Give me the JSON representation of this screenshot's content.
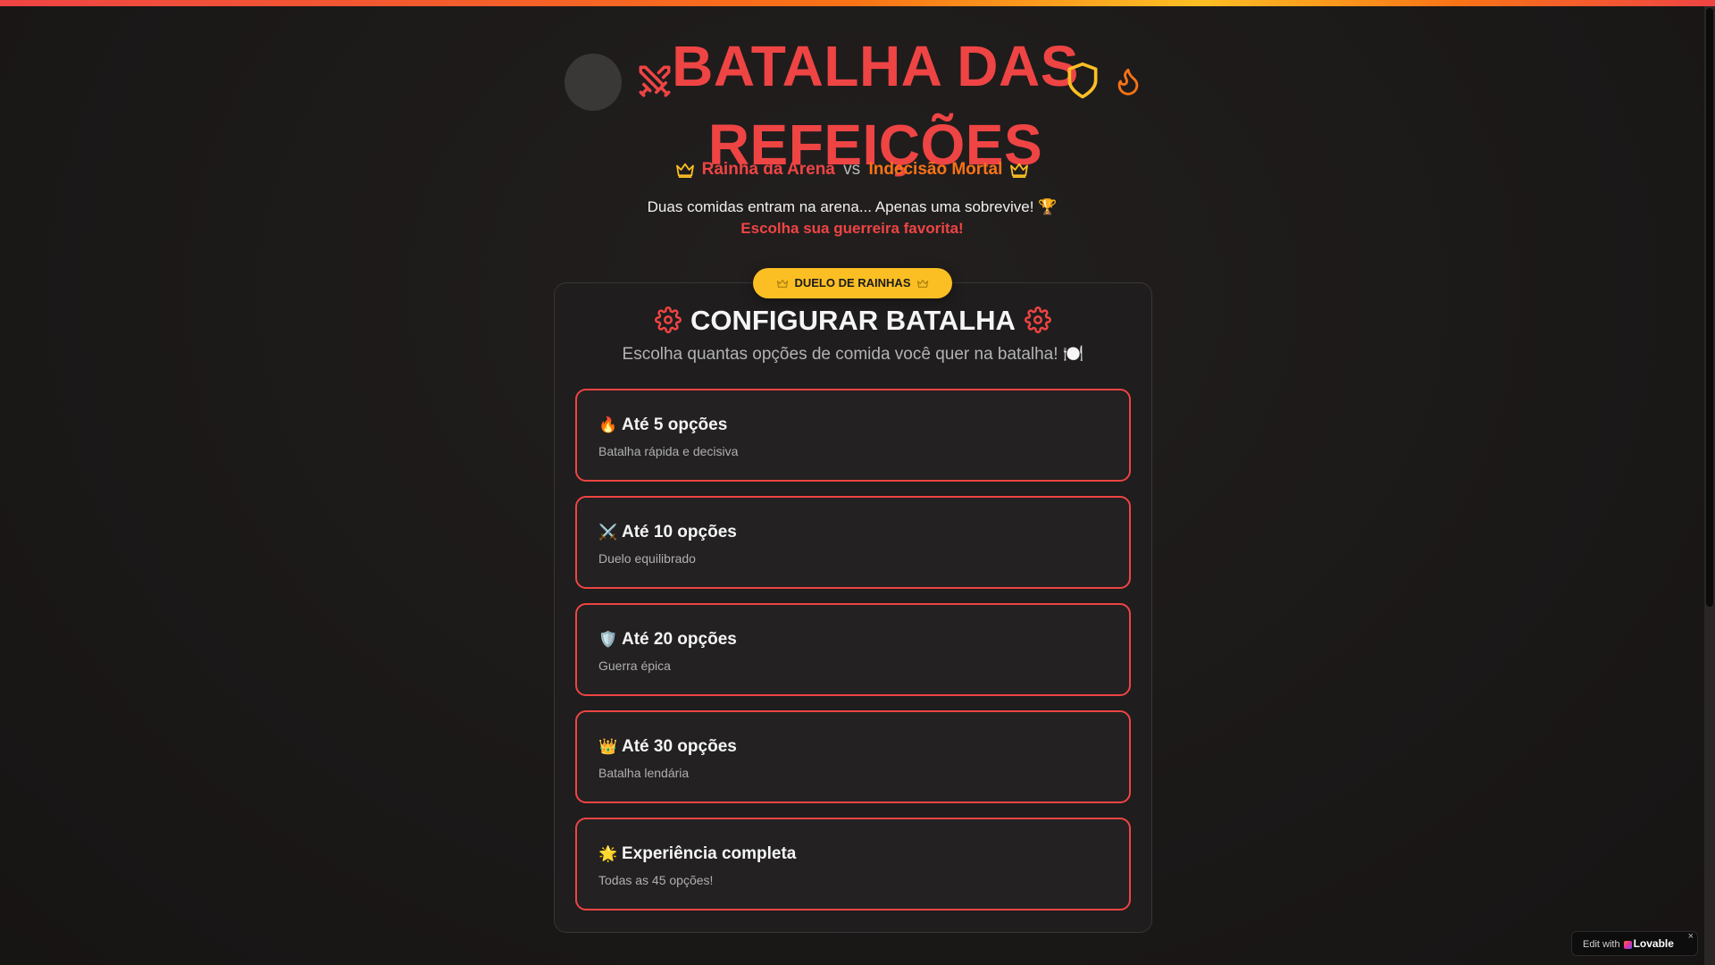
{
  "header": {
    "title_line1": "BATALHA DAS",
    "title_line2": "REFEIÇÕES",
    "queen_a": "Rainha da Arena",
    "vs": "vs",
    "queen_b": "Indecisão Mortal",
    "tagline": "Duas comidas entram na arena... Apenas uma sobrevive! 🏆",
    "cta": "Escolha sua guerreira favorita!"
  },
  "card": {
    "badge": "DUELO DE RAINHAS",
    "title": "CONFIGURAR BATALHA",
    "subtitle": "Escolha quantas opções de comida você quer na batalha! 🍽️",
    "options": [
      {
        "icon": "🔥",
        "title": "Até 5 opções",
        "desc": "Batalha rápida e decisiva"
      },
      {
        "icon": "⚔️",
        "title": "Até 10 opções",
        "desc": "Duelo equilibrado"
      },
      {
        "icon": "🛡️",
        "title": "Até 20 opções",
        "desc": "Guerra épica"
      },
      {
        "icon": "👑",
        "title": "Até 30 opções",
        "desc": "Batalha lendária"
      },
      {
        "icon": "🌟",
        "title": "Experiência completa",
        "desc": "Todas as 45 opções!"
      }
    ]
  },
  "footer": {
    "edit_with": "Edit with",
    "brand": "Lovable",
    "close": "×"
  },
  "colors": {
    "red": "#ef4444",
    "orange": "#f97316",
    "yellow": "#fbbf24"
  }
}
